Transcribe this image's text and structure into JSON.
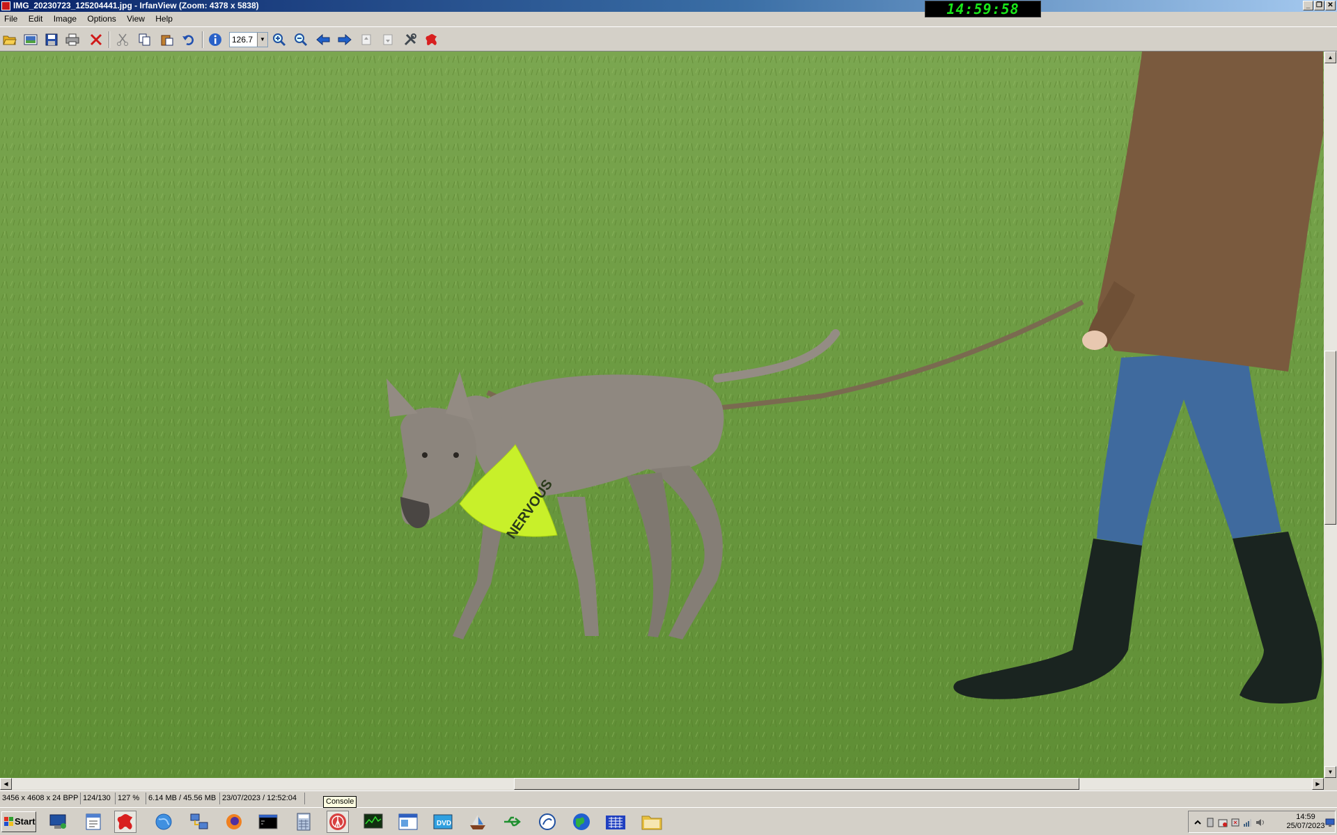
{
  "window": {
    "title": "IMG_20230723_125204441.jpg - IrfanView (Zoom: 4378 x 5838)",
    "clock": "14:59:58",
    "buttons": [
      "minimize-icon",
      "restore-icon",
      "close-icon"
    ]
  },
  "menu": [
    "File",
    "Edit",
    "Image",
    "Options",
    "View",
    "Help"
  ],
  "toolbar": {
    "zoom_value": "126.7",
    "tools": [
      "open-icon",
      "thumbnails-icon",
      "save-icon",
      "print-icon",
      "delete-icon",
      "cut-icon",
      "copy-icon",
      "paste-icon",
      "undo-icon",
      "info-icon",
      "zoom-in-icon",
      "zoom-out-icon",
      "previous-icon",
      "next-icon",
      "first-page-icon",
      "last-page-icon",
      "settings-icon",
      "irfan-logo-icon"
    ]
  },
  "image": {
    "description_badge_text": "NERVOUS",
    "colors": {
      "grass": "#6e9a3e",
      "vest": "#c8f02a",
      "dog": "#8f8880",
      "jacket": "#7a5a3e",
      "jeans": "#3f6a9e",
      "boots": "#1a2420"
    }
  },
  "statusbar": {
    "fields": [
      "3456 x 4608 x 24 BPP",
      "124/130",
      "127 %",
      "6.14 MB / 45.56 MB",
      "23/07/2023 / 12:52:04"
    ]
  },
  "tooltip": "Console",
  "taskbar": {
    "start_label": "Start",
    "quicklaunch": [
      "desktop-icon",
      "notepad-icon",
      "irfanview-icon",
      "globe-icon",
      "network-icon",
      "firefox-icon",
      "command-prompt-icon",
      "calculator-icon",
      "console-icon",
      "monitor-icon",
      "window-icon",
      "dvd-icon",
      "boat-icon",
      "usb-icon",
      "dragon-icon",
      "earth-icon",
      "grid-app-icon",
      "folder-icon"
    ],
    "tray": {
      "time": "14:59",
      "date": "25/07/2023",
      "icons": [
        "chevron-up-icon",
        "usb-tray-icon",
        "security-tray-icon",
        "safe-remove-icon",
        "network-tray-icon",
        "volume-icon",
        "monitor-tray-icon"
      ]
    }
  }
}
